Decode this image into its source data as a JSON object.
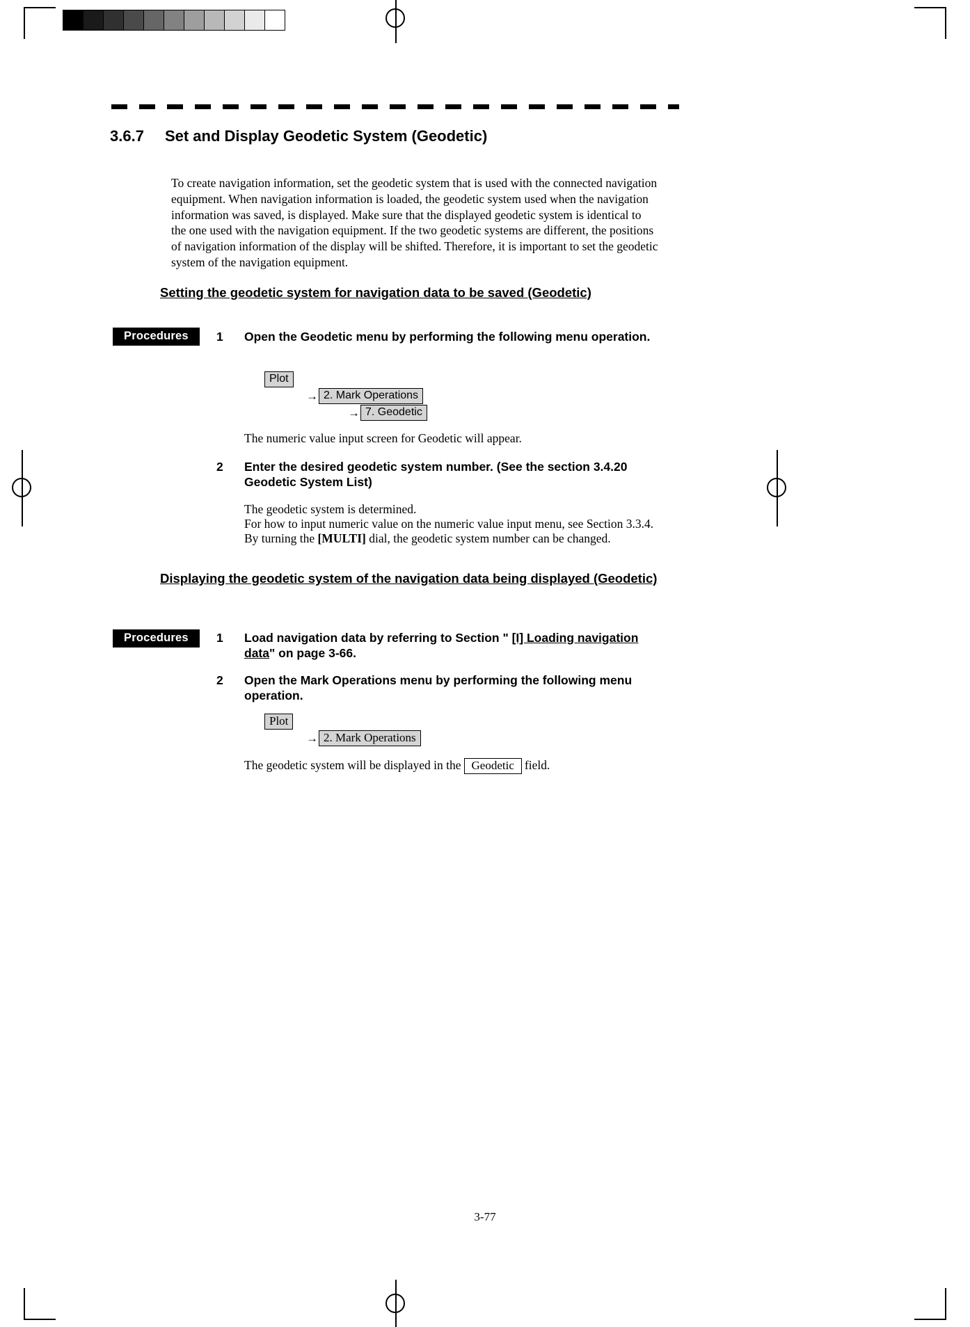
{
  "document": {
    "page_number": "3-77",
    "section": {
      "number": "3.6.7",
      "title": "Set and Display Geodetic System (Geodetic)"
    },
    "intro_paragraph": "To create navigation information, set the geodetic system that is used with the connected navigation equipment.    When navigation information is loaded, the geodetic system used when the navigation information was saved, is displayed.    Make sure that the displayed geodetic system is identical to the one used with the navigation equipment.    If the two geodetic systems are different, the positions of navigation information of the display will be shifted.    Therefore, it is important to set the geodetic system of the navigation equipment."
  },
  "section_a": {
    "heading": "Setting the geodetic system for navigation data to be saved (Geodetic)",
    "procedures_label": "Procedures",
    "step1": {
      "number": "1",
      "text": "Open the Geodetic menu by performing the following menu operation."
    },
    "menu_path": {
      "root": "Plot",
      "arrow": "→",
      "items": [
        "2. Mark Operations",
        "7. Geodetic"
      ]
    },
    "note_after_menu": "The numeric value input screen for Geodetic will appear.",
    "step2": {
      "number": "2",
      "text": "Enter the desired geodetic system number.    (See the section 3.4.20 Geodetic System List)"
    },
    "note_after_step2": {
      "line1": "The geodetic system is determined.",
      "line2": "For how to input numeric value on the numeric value input menu, see Section 3.3.4.",
      "line3_before": "By turning the ",
      "line3_bold": "[MULTI]",
      "line3_after": " dial, the geodetic system number can be changed."
    }
  },
  "section_b": {
    "heading": "Displaying the geodetic system of the navigation data being displayed (Geodetic)",
    "procedures_label": "Procedures",
    "step1": {
      "number": "1",
      "text_before": "Load navigation data by referring to Section \" ",
      "link_text": "[I]    Loading navigation data",
      "text_after": "\" on page 3-66."
    },
    "step2": {
      "number": "2",
      "text": "Open the Mark Operations menu by performing the following menu operation."
    },
    "menu_path": {
      "root": "Plot",
      "arrow": "→",
      "items": [
        "2. Mark Operations"
      ]
    },
    "closing_note": {
      "text_before": "The geodetic system will be displayed in the",
      "field_label": "Geodetic",
      "text_after": "field."
    }
  },
  "colors": {
    "menu_box_fill": "#d4d4d4",
    "badge_background": "#000000",
    "badge_text": "#ffffff",
    "page_background": "#ffffff",
    "ink": "#000000"
  },
  "calibration_strip": {
    "name": "grayscale-calibration-strip",
    "swatches": [
      "#000000",
      "#1a1a1a",
      "#303030",
      "#4a4a4a",
      "#666666",
      "#828282",
      "#9e9e9e",
      "#b8b8b8",
      "#d2d2d2",
      "#eaeaea",
      "#ffffff"
    ]
  }
}
